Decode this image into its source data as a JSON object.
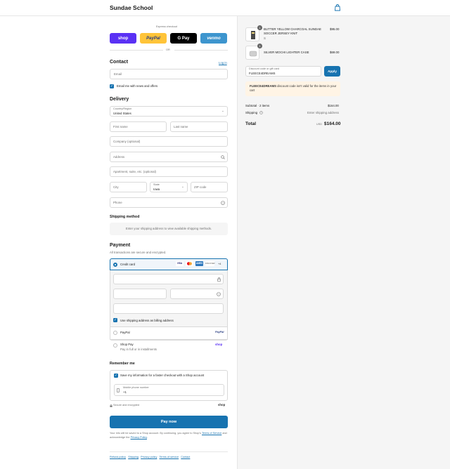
{
  "header": {
    "store_name": "Sundae School"
  },
  "express": {
    "title": "Express checkout",
    "shop": "shop",
    "paypal": "PayPal",
    "gpay": "G Pay",
    "venmo": "venmo",
    "or": "OR"
  },
  "contact": {
    "heading": "Contact",
    "login": "Log in",
    "email_placeholder": "Email",
    "news_label": "Email me with news and offers"
  },
  "delivery": {
    "heading": "Delivery",
    "country_label": "Country/Region",
    "country_value": "United States",
    "first_name": "First name",
    "last_name": "Last name",
    "company": "Company (optional)",
    "address": "Address",
    "apartment": "Apartment, suite, etc. (optional)",
    "city": "City",
    "state_label": "State",
    "state_value": "Iowa",
    "zip": "ZIP code",
    "phone": "Phone"
  },
  "shipping": {
    "heading": "Shipping method",
    "notice": "Enter your shipping address to view available shipping methods."
  },
  "payment": {
    "heading": "Payment",
    "subtitle": "All transactions are secure and encrypted.",
    "credit_card": "Credit card",
    "more_cards": "+4",
    "billing_label": "Use shipping address as billing address",
    "paypal": "PayPal",
    "paypal_logo": "PayPal",
    "shop_pay": "Shop Pay",
    "shop_pay_sub": "Pay in full or in installments",
    "shop_logo": "shop",
    "card_brands": [
      "VISA",
      "MC",
      "AMEX",
      "DISCOVER"
    ]
  },
  "remember": {
    "heading": "Remember me",
    "save_label": "Save my information for a faster checkout with a Shop account",
    "phone_label": "Mobile phone number",
    "phone_value": "+1",
    "secure": "Secure and encrypted",
    "shop_logo": "shop"
  },
  "pay_button": "Pay now",
  "legal": {
    "line1": "Your info will be saved to a Shop account. By continuing, you agree to Shop's",
    "tos": "Terms of Service",
    "mid": "and acknowledge the",
    "privacy": "Privacy Policy",
    "end": "."
  },
  "footer_links": [
    "Refund policy",
    "Shipping",
    "Privacy policy",
    "Terms of service",
    "Contact"
  ],
  "cart": {
    "items": [
      {
        "qty": "1",
        "name": "BUTTER YELLOW CHARCOAL SUNDAE SOCCER JERSEY KNIT",
        "variant": "S",
        "price": "$95.00"
      },
      {
        "qty": "1",
        "name": "SILVER MOCHI LIGHTER CASE",
        "variant": "",
        "price": "$69.00"
      }
    ],
    "discount_label": "Discount code or gift card",
    "discount_value": "FLEECE4DREAMS",
    "apply": "Apply",
    "warning_code": "FLEECE4DREAMS",
    "warning_text": "discount code isn't valid for the items in your cart",
    "subtotal_label": "Subtotal · 2 items",
    "subtotal_value": "$164.00",
    "shipping_label": "Shipping",
    "shipping_value": "Enter shipping address",
    "total_label": "Total",
    "currency": "USD",
    "total_value": "$164.00"
  }
}
